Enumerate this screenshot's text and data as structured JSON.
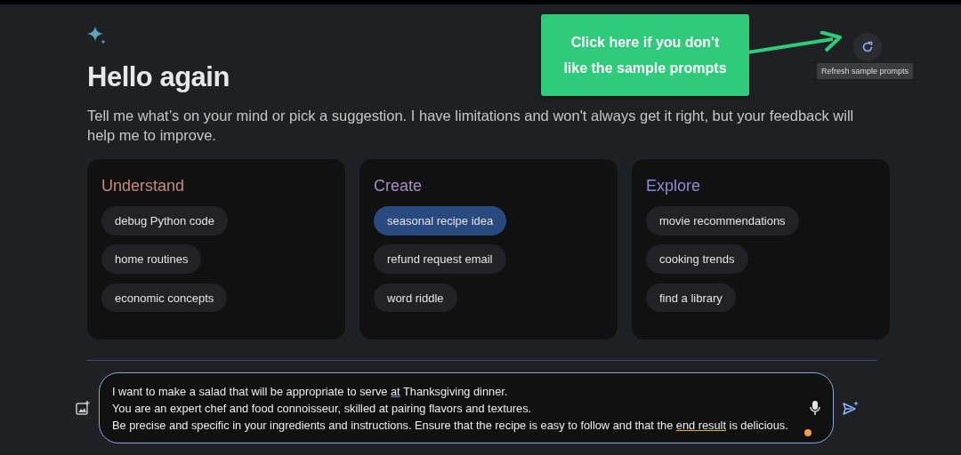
{
  "header": {
    "title": "Hello again",
    "intro": "Tell me what’s on your mind or pick a suggestion. I have limitations and won't always get it right, but your feedback will help me to improve."
  },
  "refresh": {
    "tooltip": "Refresh sample prompts"
  },
  "callout": {
    "text": "Click here if you don't like the sample prompts"
  },
  "cards": [
    {
      "title": "Understand",
      "color": "#c48b7d",
      "chips": [
        {
          "label": "debug Python code",
          "selected": false
        },
        {
          "label": "home routines",
          "selected": false
        },
        {
          "label": "economic concepts",
          "selected": false
        }
      ]
    },
    {
      "title": "Create",
      "color": "#a68dc4",
      "chips": [
        {
          "label": "seasonal recipe idea",
          "selected": true
        },
        {
          "label": "refund request email",
          "selected": false
        },
        {
          "label": "word riddle",
          "selected": false
        }
      ]
    },
    {
      "title": "Explore",
      "color": "#8e8ad6",
      "chips": [
        {
          "label": "movie recommendations",
          "selected": false
        },
        {
          "label": "cooking trends",
          "selected": false
        },
        {
          "label": "find a library",
          "selected": false
        }
      ]
    }
  ],
  "prompt": {
    "lines": [
      [
        {
          "text": "I want to make a salad that will be appropriate to serve ",
          "kind": "plain"
        },
        {
          "text": "at",
          "kind": "spelling"
        },
        {
          "text": " Thanksgiving dinner.",
          "kind": "plain"
        }
      ],
      [
        {
          "text": "You are an expert chef and food connoisseur, skilled at pairing flavors and textures.",
          "kind": "plain"
        }
      ],
      [
        {
          "text": "Be precise and specific in your ingredients and instructions. Ensure that the recipe is easy to follow and that the ",
          "kind": "plain"
        },
        {
          "text": "end result",
          "kind": "grammar"
        },
        {
          "text": " is delicious.",
          "kind": "plain"
        }
      ]
    ]
  }
}
